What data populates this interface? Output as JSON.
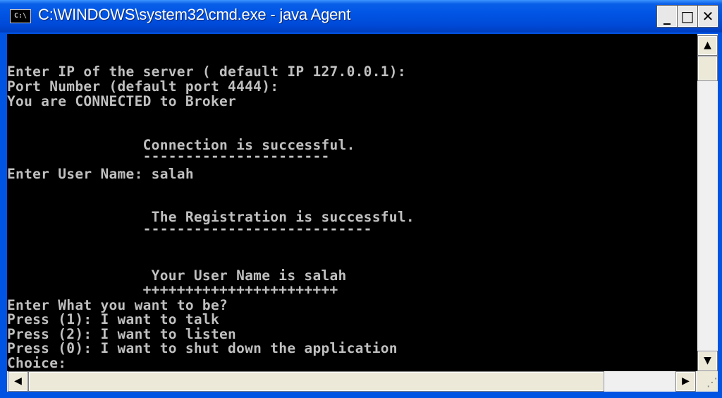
{
  "window": {
    "title": "C:\\WINDOWS\\system32\\cmd.exe - java Agent",
    "icon_label": "C:\\",
    "icon": "cmd-icon",
    "buttons": {
      "minimize": "_",
      "maximize": "□",
      "close": "✕"
    }
  },
  "console": {
    "lines": [
      "Enter IP of the server ( default IP 127.0.0.1):",
      "Port Number (default port 4444):",
      "You are CONNECTED to Broker",
      "                Connection is successful.",
      "                ----------------------",
      "Enter User Name: salah",
      "                 The Registration is successful.",
      "                ---------------------------",
      "                 Your User Name is salah",
      "                +++++++++++++++++++++++",
      "Enter What you want to be?",
      "Press (1): I want to talk",
      "Press (2): I want to listen",
      "Press (0): I want to shut down the application",
      "Choice:"
    ]
  },
  "scrollbar": {
    "up": "▲",
    "down": "▼",
    "left": "◀",
    "right": "▶",
    "grip": "⋰"
  }
}
